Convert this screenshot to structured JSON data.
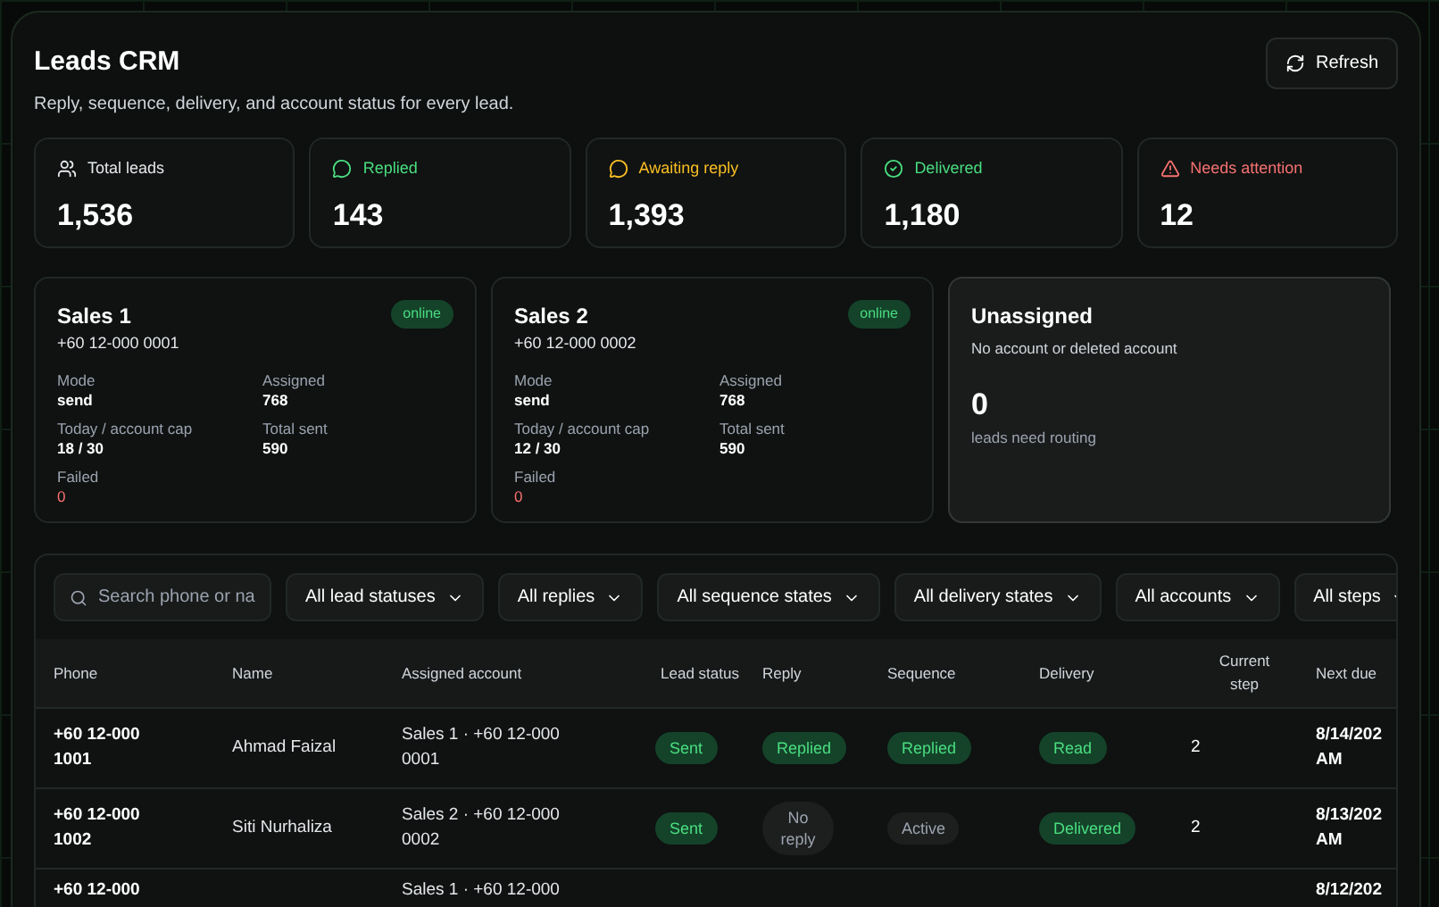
{
  "header": {
    "title": "Leads CRM",
    "subtitle": "Reply, sequence, delivery, and account status for every lead.",
    "refresh_button": "Refresh"
  },
  "stats": [
    {
      "kind": "total",
      "label": "Total leads",
      "value": "1,536",
      "color": "#e5e7eb"
    },
    {
      "kind": "replied",
      "label": "Replied",
      "value": "143",
      "color": "#4ade80"
    },
    {
      "kind": "awaiting",
      "label": "Awaiting reply",
      "value": "1,393",
      "color": "#fbbf24"
    },
    {
      "kind": "delivered",
      "label": "Delivered",
      "value": "1,180",
      "color": "#4ade80"
    },
    {
      "kind": "attention",
      "label": "Needs attention",
      "value": "12",
      "color": "#f87171"
    }
  ],
  "accounts": [
    {
      "name": "Sales 1",
      "phone": "+60 12-000 0001",
      "status": "online",
      "online": true,
      "fields": [
        {
          "label": "Mode",
          "value": "send"
        },
        {
          "label": "Assigned",
          "value": "768"
        },
        {
          "label": "Today / account cap",
          "value": "18 / 30"
        },
        {
          "label": "Total sent",
          "value": "590"
        },
        {
          "label": "Failed",
          "value": "0",
          "alert": true
        }
      ]
    },
    {
      "name": "Sales 2",
      "phone": "+60 12-000 0002",
      "status": "online",
      "online": true,
      "fields": [
        {
          "label": "Mode",
          "value": "send"
        },
        {
          "label": "Assigned",
          "value": "768"
        },
        {
          "label": "Today / account cap",
          "value": "12 / 30"
        },
        {
          "label": "Total sent",
          "value": "590"
        },
        {
          "label": "Failed",
          "value": "0",
          "alert": true
        }
      ]
    }
  ],
  "unassigned": {
    "title": "Unassigned",
    "subtitle": "No account or deleted account",
    "count": "0",
    "caption": "leads need routing"
  },
  "filters": {
    "search_placeholder": "Search phone or na",
    "selects": [
      "All lead statuses",
      "All replies",
      "All sequence states",
      "All delivery states",
      "All accounts",
      "All steps"
    ]
  },
  "table": {
    "columns": [
      "Phone",
      "Name",
      "Assigned account",
      "Lead status",
      "Reply",
      "Sequence",
      "Delivery",
      "Current step",
      "Next due"
    ],
    "rows": [
      {
        "phone": [
          "+60 12-000",
          "1001"
        ],
        "name": "Ahmad Faizal",
        "account": [
          "Sales 1 · +60 12-000",
          "0001"
        ],
        "lead_status": {
          "text": "Sent",
          "kind": "success"
        },
        "reply": {
          "text": "Replied",
          "kind": "success"
        },
        "sequence": {
          "text": "Replied",
          "kind": "success"
        },
        "delivery": {
          "text": "Read",
          "kind": "success"
        },
        "step": "2",
        "next_due": [
          "8/14/202",
          "AM"
        ]
      },
      {
        "phone": [
          "+60 12-000",
          "1002"
        ],
        "name": "Siti Nurhaliza",
        "account": [
          "Sales 2 · +60 12-000",
          "0002"
        ],
        "lead_status": {
          "text": "Sent",
          "kind": "success"
        },
        "reply": {
          "text": "No reply",
          "kind": "neutral"
        },
        "sequence": {
          "text": "Active",
          "kind": "neutral"
        },
        "delivery": {
          "text": "Delivered",
          "kind": "success"
        },
        "step": "2",
        "next_due": [
          "8/13/202",
          "AM"
        ]
      },
      {
        "phone": [
          "+60 12-000"
        ],
        "account": [
          "Sales 1 · +60 12-000"
        ],
        "next_due": [
          "8/12/202"
        ]
      }
    ]
  }
}
